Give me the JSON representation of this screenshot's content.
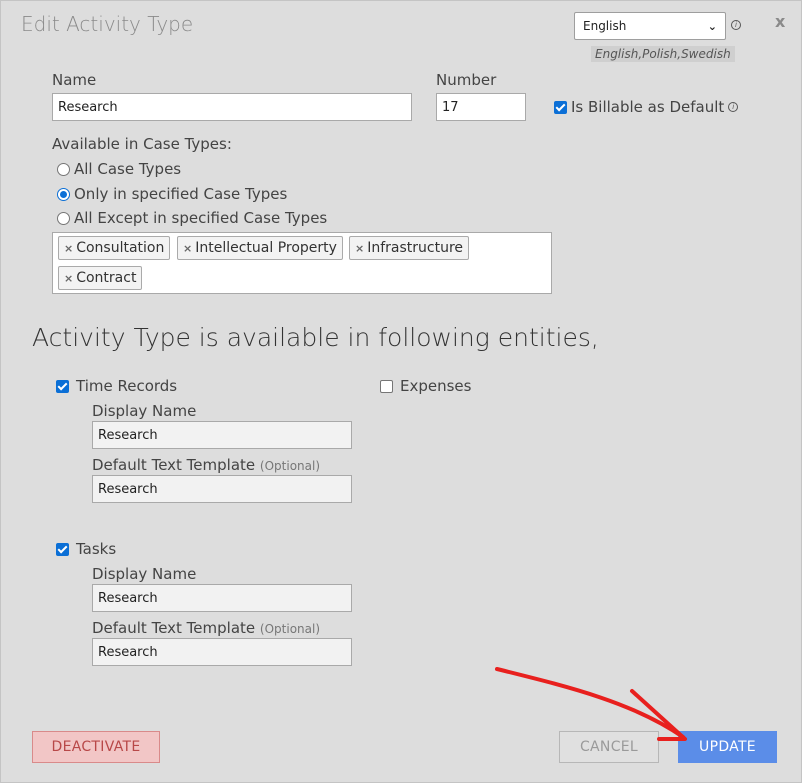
{
  "dialog": {
    "title": "Edit Activity Type",
    "close_label": "x"
  },
  "language": {
    "selected": "English",
    "available_hint": "English,Polish,Swedish",
    "info_glyph": "i"
  },
  "fields": {
    "name_label": "Name",
    "name_value": "Research",
    "number_label": "Number",
    "number_value": "17",
    "billable_label": "Is Billable as Default",
    "billable_checked": true
  },
  "case_types": {
    "label": "Available in Case Types:",
    "options": [
      {
        "label": "All Case Types",
        "selected": false
      },
      {
        "label": "Only in specified Case Types",
        "selected": true
      },
      {
        "label": "All Except in specified Case Types",
        "selected": false
      }
    ],
    "tags": [
      "Consultation",
      "Intellectual Property",
      "Infrastructure",
      "Contract"
    ]
  },
  "entities": {
    "heading": "Activity Type is available in following entities,",
    "time_records": {
      "label": "Time Records",
      "checked": true,
      "display_name_label": "Display Name",
      "display_name_value": "Research",
      "template_label": "Default Text Template",
      "template_optional": "(Optional)",
      "template_value": "Research"
    },
    "expenses": {
      "label": "Expenses",
      "checked": false
    },
    "tasks": {
      "label": "Tasks",
      "checked": true,
      "display_name_label": "Display Name",
      "display_name_value": "Research",
      "template_label": "Default Text Template",
      "template_optional": "(Optional)",
      "template_value": "Research"
    }
  },
  "buttons": {
    "deactivate": "DEACTIVATE",
    "cancel": "CANCEL",
    "update": "UPDATE"
  },
  "colors": {
    "accent": "#0b6fd6",
    "update_button": "#5b8de8",
    "deactivate_button": "#f2c6c6",
    "annotation_arrow": "#e8201e"
  },
  "icons": {
    "tag_remove": "×",
    "select_chevron": "⌄"
  }
}
